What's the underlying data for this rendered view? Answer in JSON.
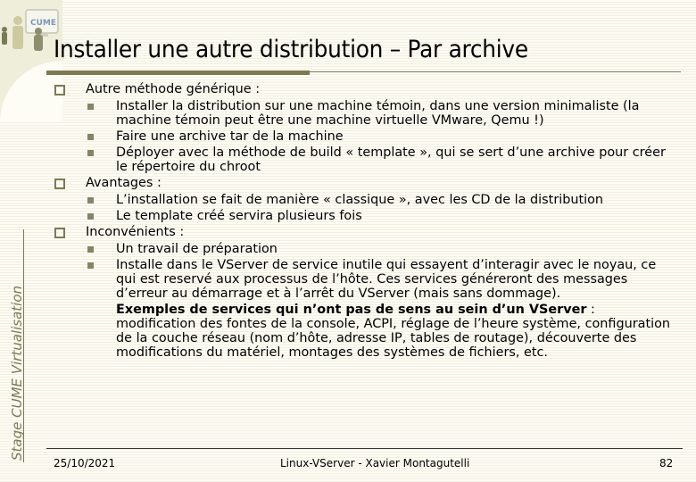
{
  "slide": {
    "logo_text": "CUME",
    "title": "Installer une autre distribution – Par archive",
    "side_label": "Stage CUME Virtualisation",
    "sections": [
      {
        "heading": "Autre méthode générique :",
        "items": [
          "Installer la distribution sur une machine témoin, dans une version minimaliste (la machine témoin peut être une machine virtuelle VMware, Qemu !)",
          "Faire une archive tar de la machine",
          "Déployer avec la méthode de build « template », qui se sert d’une archive pour créer le répertoire du chroot"
        ]
      },
      {
        "heading": "Avantages :",
        "items": [
          "L’installation se fait de manière « classique », avec les CD de la distribution",
          "Le template créé servira plusieurs fois"
        ]
      },
      {
        "heading": "Inconvénients :",
        "items": [
          "Un travail de préparation",
          "Installe dans le VServer de service inutile qui essayent d’interagir avec le noyau, ce qui est reservé aux processus de l’hôte. Ces services généreront des messages d’erreur au démarrage et à l’arrêt du VServer (mais sans dommage)."
        ],
        "examples_bold": "Exemples de services qui n’ont pas de sens au sein d’un VServer",
        "examples_rest": " : modification des fontes de la console, ACPI, réglage de l’heure système, configuration de la couche réseau (nom d’hôte, adresse IP, tables de routage), découverte des modifications du matériel, montages des systèmes de fichiers, etc."
      }
    ]
  },
  "footer": {
    "date": "25/10/2021",
    "center": "Linux-VServer - Xavier Montagutelli",
    "page": "82"
  },
  "colors": {
    "accent": "#7b7a55",
    "panel": "#eeeedb",
    "background": "#fdfcf5"
  }
}
